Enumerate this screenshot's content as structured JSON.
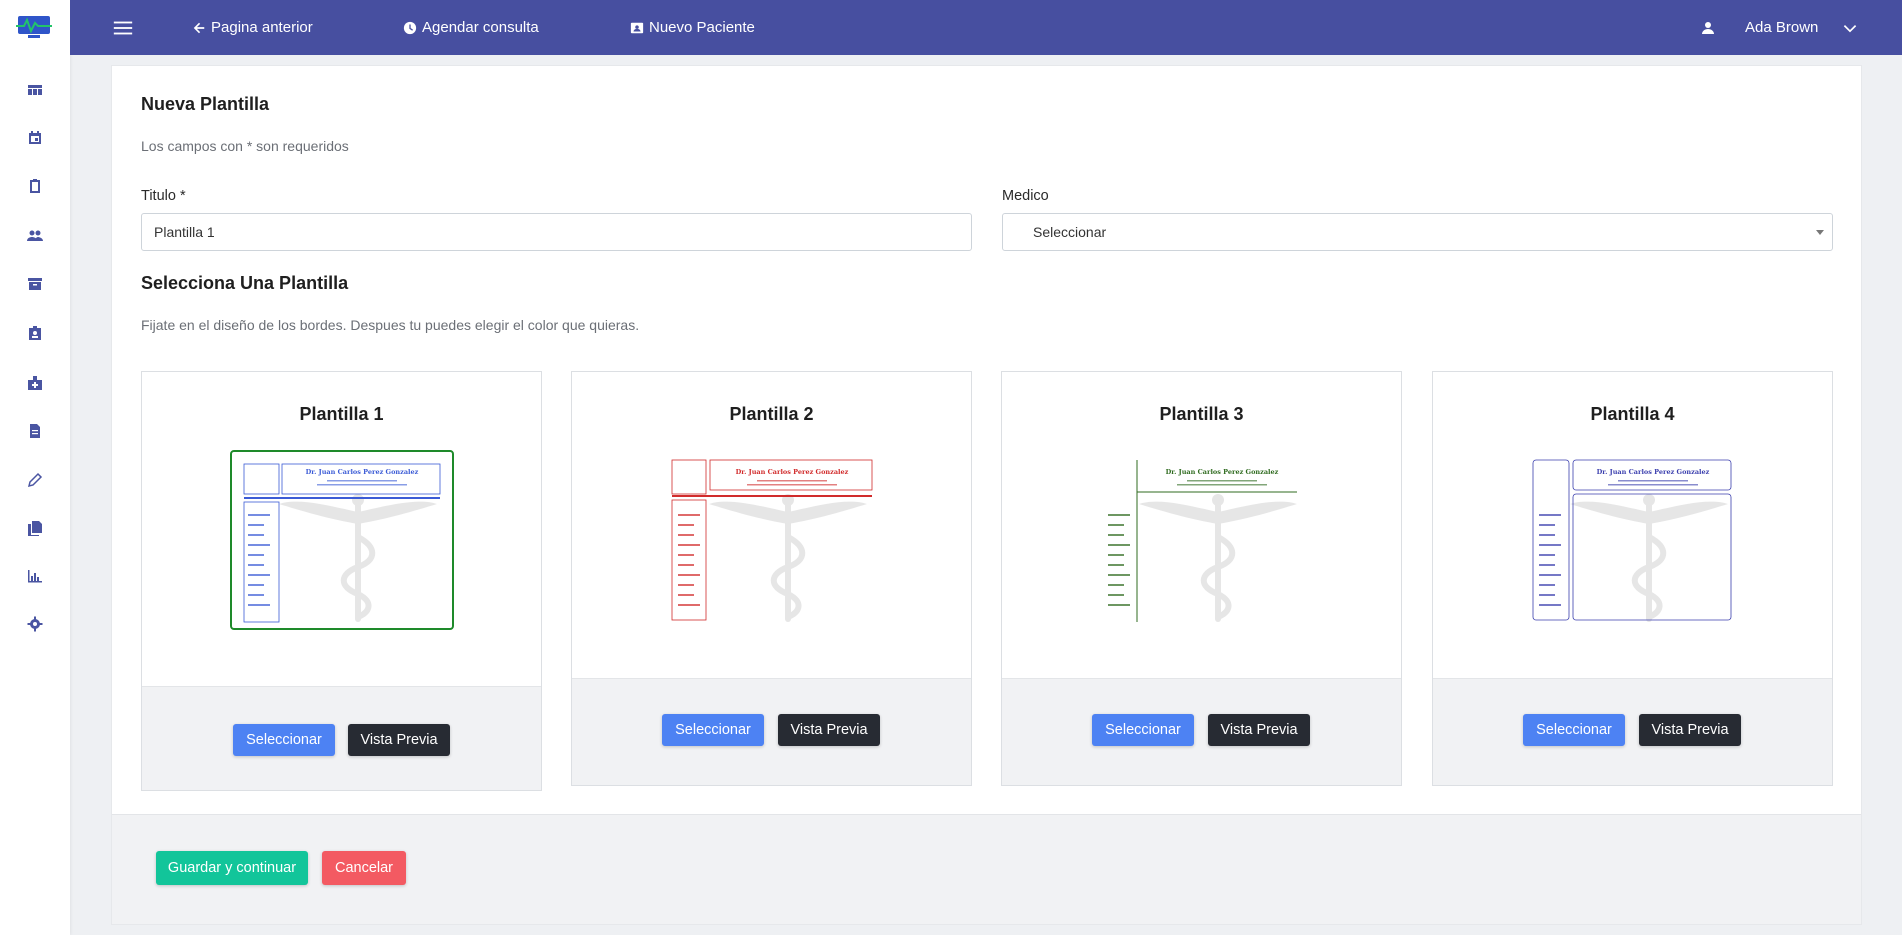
{
  "topbar": {
    "back_label": "Pagina anterior",
    "agenda_label": "Agendar consulta",
    "patient_label": "Nuevo Paciente",
    "user_name": "Ada Brown"
  },
  "sidebar": {
    "icons": [
      "dashboard-icon",
      "calendar-icon",
      "clipboard-icon",
      "people-icon",
      "archive-icon",
      "badge-icon",
      "hospital-icon",
      "document-icon",
      "pen-icon",
      "file-icon",
      "chart-icon",
      "settings-icon"
    ]
  },
  "form": {
    "title": "Nueva Plantilla",
    "required_note": "Los campos con * son requeridos",
    "titulo_label": "Titulo *",
    "titulo_value": "Plantilla 1",
    "medico_label": "Medico",
    "medico_value": "Seleccionar",
    "section_title": "Selecciona Una Plantilla",
    "section_note": "Fijate en el diseño de los bordes. Despues tu puedes elegir el color que quieras."
  },
  "templates": [
    {
      "name": "Plantilla 1",
      "select_label": "Seleccionar",
      "preview_label": "Vista Previa",
      "color": "#3b5bd6",
      "selected": true
    },
    {
      "name": "Plantilla 2",
      "select_label": "Seleccionar",
      "preview_label": "Vista Previa",
      "color": "#d12b2b",
      "selected": false
    },
    {
      "name": "Plantilla 3",
      "select_label": "Seleccionar",
      "preview_label": "Vista Previa",
      "color": "#2f6b1f",
      "selected": false
    },
    {
      "name": "Plantilla 4",
      "select_label": "Seleccionar",
      "preview_label": "Vista Previa",
      "color": "#3b3fae",
      "selected": false
    }
  ],
  "thumbnail": {
    "doctor_name": "Dr. Juan Carlos Perez Gonzalez"
  },
  "actions": {
    "save_label": "Guardar y continuar",
    "cancel_label": "Cancelar"
  },
  "colors": {
    "topbar": "#474fa0",
    "primary": "#4d82f3",
    "dark": "#272b33",
    "success": "#12c59a",
    "danger": "#f35a62",
    "selected_outline": "#1e8a2a"
  }
}
